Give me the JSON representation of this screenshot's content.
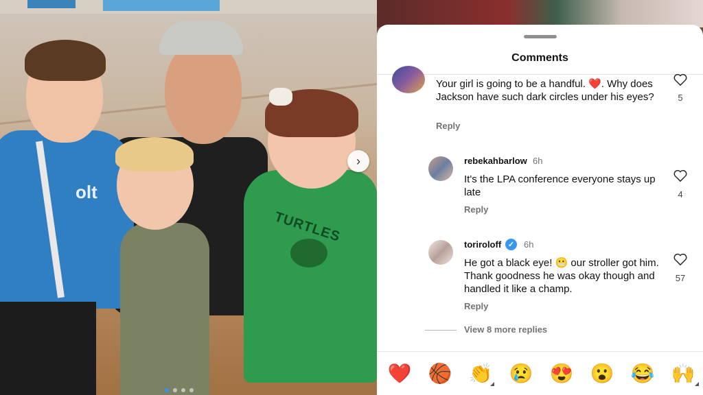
{
  "photo": {
    "shirt_text": "TURTLES",
    "kid_shirt_text": "olt",
    "next_icon": "chevron-right-icon",
    "carousel_total": 4,
    "carousel_active": 1
  },
  "sheet": {
    "title": "Comments"
  },
  "comments": [
    {
      "username": "",
      "time": "",
      "text": "Your girl is going to be a handful. ❤️. Why does Jackson have such dark circles under his eyes?",
      "reply_label": "Reply",
      "likes": "5"
    },
    {
      "username": "rebekahbarlow",
      "time": "6h",
      "text": "It's the LPA conference everyone stays up late",
      "reply_label": "Reply",
      "likes": "4"
    },
    {
      "username": "toriroloff",
      "verified": true,
      "time": "6h",
      "text": "He got a black eye! 😬 our stroller got him. Thank goodness he was okay though and handled it like a champ.",
      "reply_label": "Reply",
      "likes": "57"
    }
  ],
  "view_more": "View 8 more replies",
  "emoji_bar": [
    "❤️",
    "🏀",
    "👏",
    "😢",
    "😍",
    "😮",
    "😂",
    "🙌"
  ],
  "colors": {
    "verified": "#3897f0",
    "carousel_active": "#3a93f2"
  }
}
